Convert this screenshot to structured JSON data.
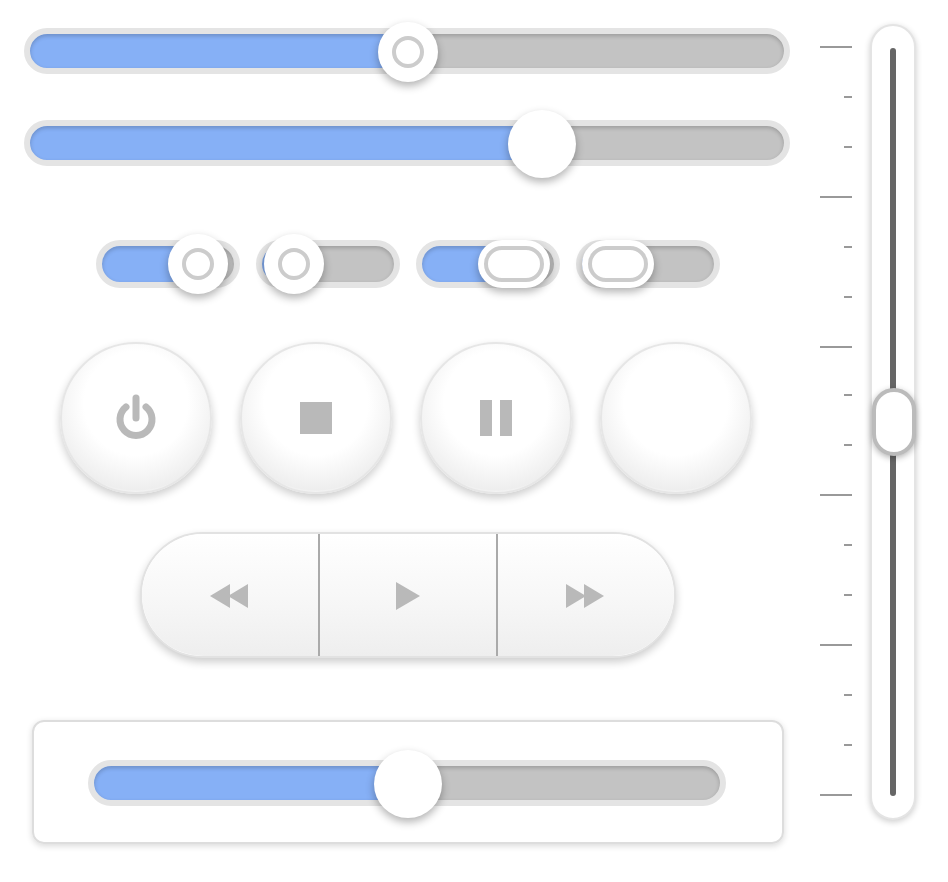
{
  "sliders": [
    {
      "kind": "ring",
      "level": 0.5
    },
    {
      "kind": "solid",
      "level": 0.68
    }
  ],
  "small_sliders": [
    {
      "kind": "ring",
      "level": 0.72
    },
    {
      "kind": "ring",
      "level": 0.24
    },
    {
      "kind": "pill",
      "level": 0.7
    },
    {
      "kind": "pill",
      "level": 0.28
    }
  ],
  "round_buttons": [
    {
      "kind": "power"
    },
    {
      "kind": "stop"
    },
    {
      "kind": "pause"
    },
    {
      "kind": "blank"
    }
  ],
  "transport": [
    {
      "kind": "rewind"
    },
    {
      "kind": "play"
    },
    {
      "kind": "fast-forward"
    }
  ],
  "panel_slider": {
    "kind": "solid",
    "level": 0.5
  },
  "vertical_slider": {
    "level": 0.5
  }
}
